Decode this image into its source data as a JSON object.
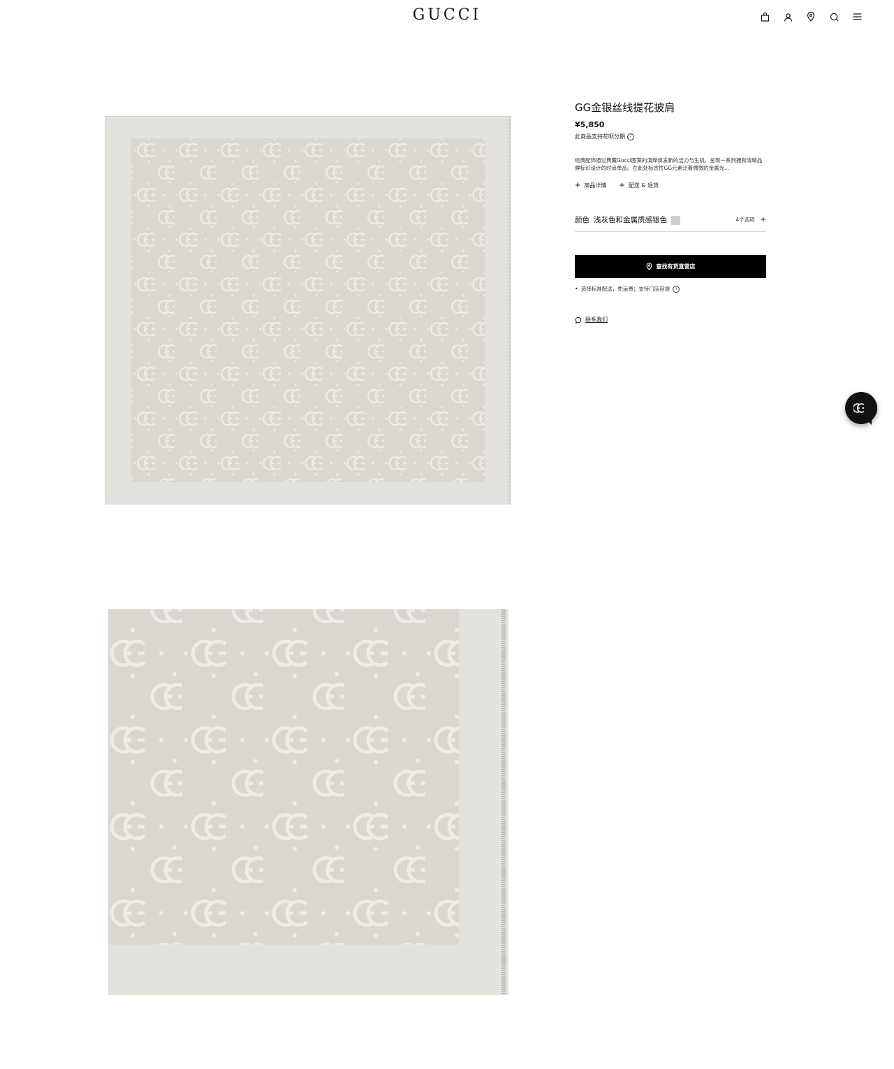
{
  "header": {
    "logo": "GUCCI",
    "icons": [
      "bag-icon",
      "user-icon",
      "location-icon",
      "search-icon",
      "menu-icon"
    ]
  },
  "product": {
    "title": "GG金银丝线提花披肩",
    "price": "¥5,850",
    "installment": "此商品支持花呗分期",
    "description": "经典配饰通过典藏Gucci图案的演绎焕发新的活力与生机，呈现一系列拥有清晰品牌标识设计的时尚单品。在此处标志性GG元素泛着微微的金属光...",
    "links": [
      "商品详情",
      "配送 & 退货"
    ],
    "color_label": "颜色",
    "color_value": "浅灰色和金属质感银色",
    "swatch_color": "#cfcfcf",
    "options": "4个选项",
    "cta_label": "查找有货直营店",
    "shipping_note": "选择标准配送，免运费；支持门店自提",
    "contact_label": "联系我们"
  },
  "colors": {
    "accent": "#000000",
    "scarf_bg": "#dad7d1",
    "scarf_border": "#e4e2dd",
    "monogram": "#efece6"
  }
}
